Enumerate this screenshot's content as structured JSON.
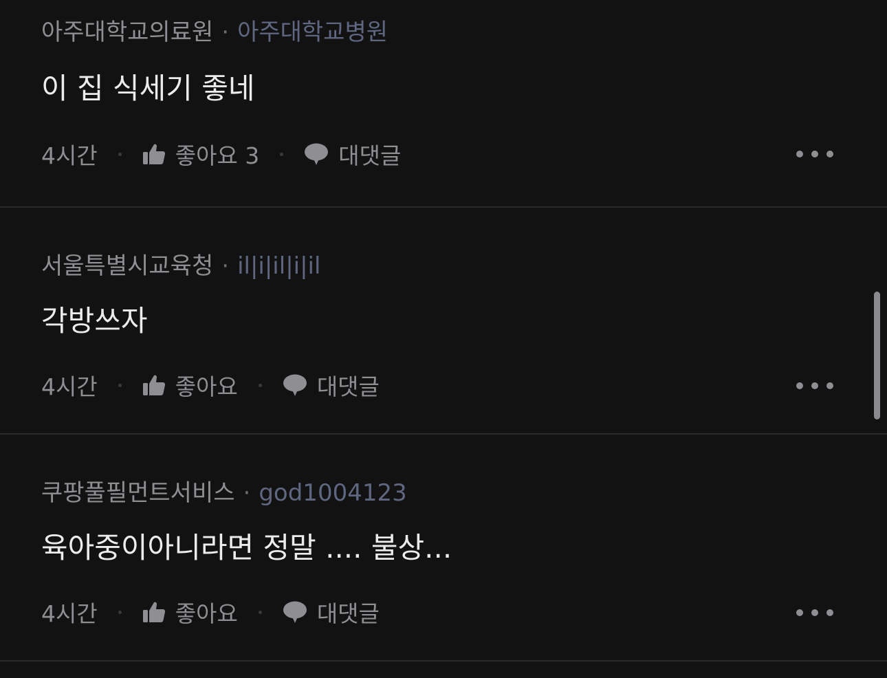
{
  "comments": [
    {
      "org": "아주대학교의료원",
      "separator": "·",
      "nickname": "아주대학교병원",
      "text": "이 집 식세기 좋네",
      "time": "4시간",
      "like_label": "좋아요 3",
      "reply_label": "대댓글",
      "like_icon": "thumbs-up-icon",
      "reply_icon": "speech-bubble-icon",
      "more_icon": "more-dots-icon"
    },
    {
      "org": "서울특별시교육청",
      "separator": "·",
      "nickname": "il|i|il|i|il",
      "text": "각방쓰자",
      "time": "4시간",
      "like_label": "좋아요",
      "reply_label": "대댓글",
      "like_icon": "thumbs-up-icon",
      "reply_icon": "speech-bubble-icon",
      "more_icon": "more-dots-icon"
    },
    {
      "org": "쿠팡풀필먼트서비스",
      "separator": "·",
      "nickname": "god1004123",
      "text": "육아중이아니라면 정말 .... 불상...",
      "time": "4시간",
      "like_label": "좋아요",
      "reply_label": "대댓글",
      "like_icon": "thumbs-up-icon",
      "reply_icon": "speech-bubble-icon",
      "more_icon": "more-dots-icon"
    }
  ],
  "colors": {
    "background": "#121213",
    "text_primary": "#ececee",
    "text_secondary": "#8e8e93",
    "nickname": "#5f6680",
    "divider": "#2a2a2c"
  }
}
